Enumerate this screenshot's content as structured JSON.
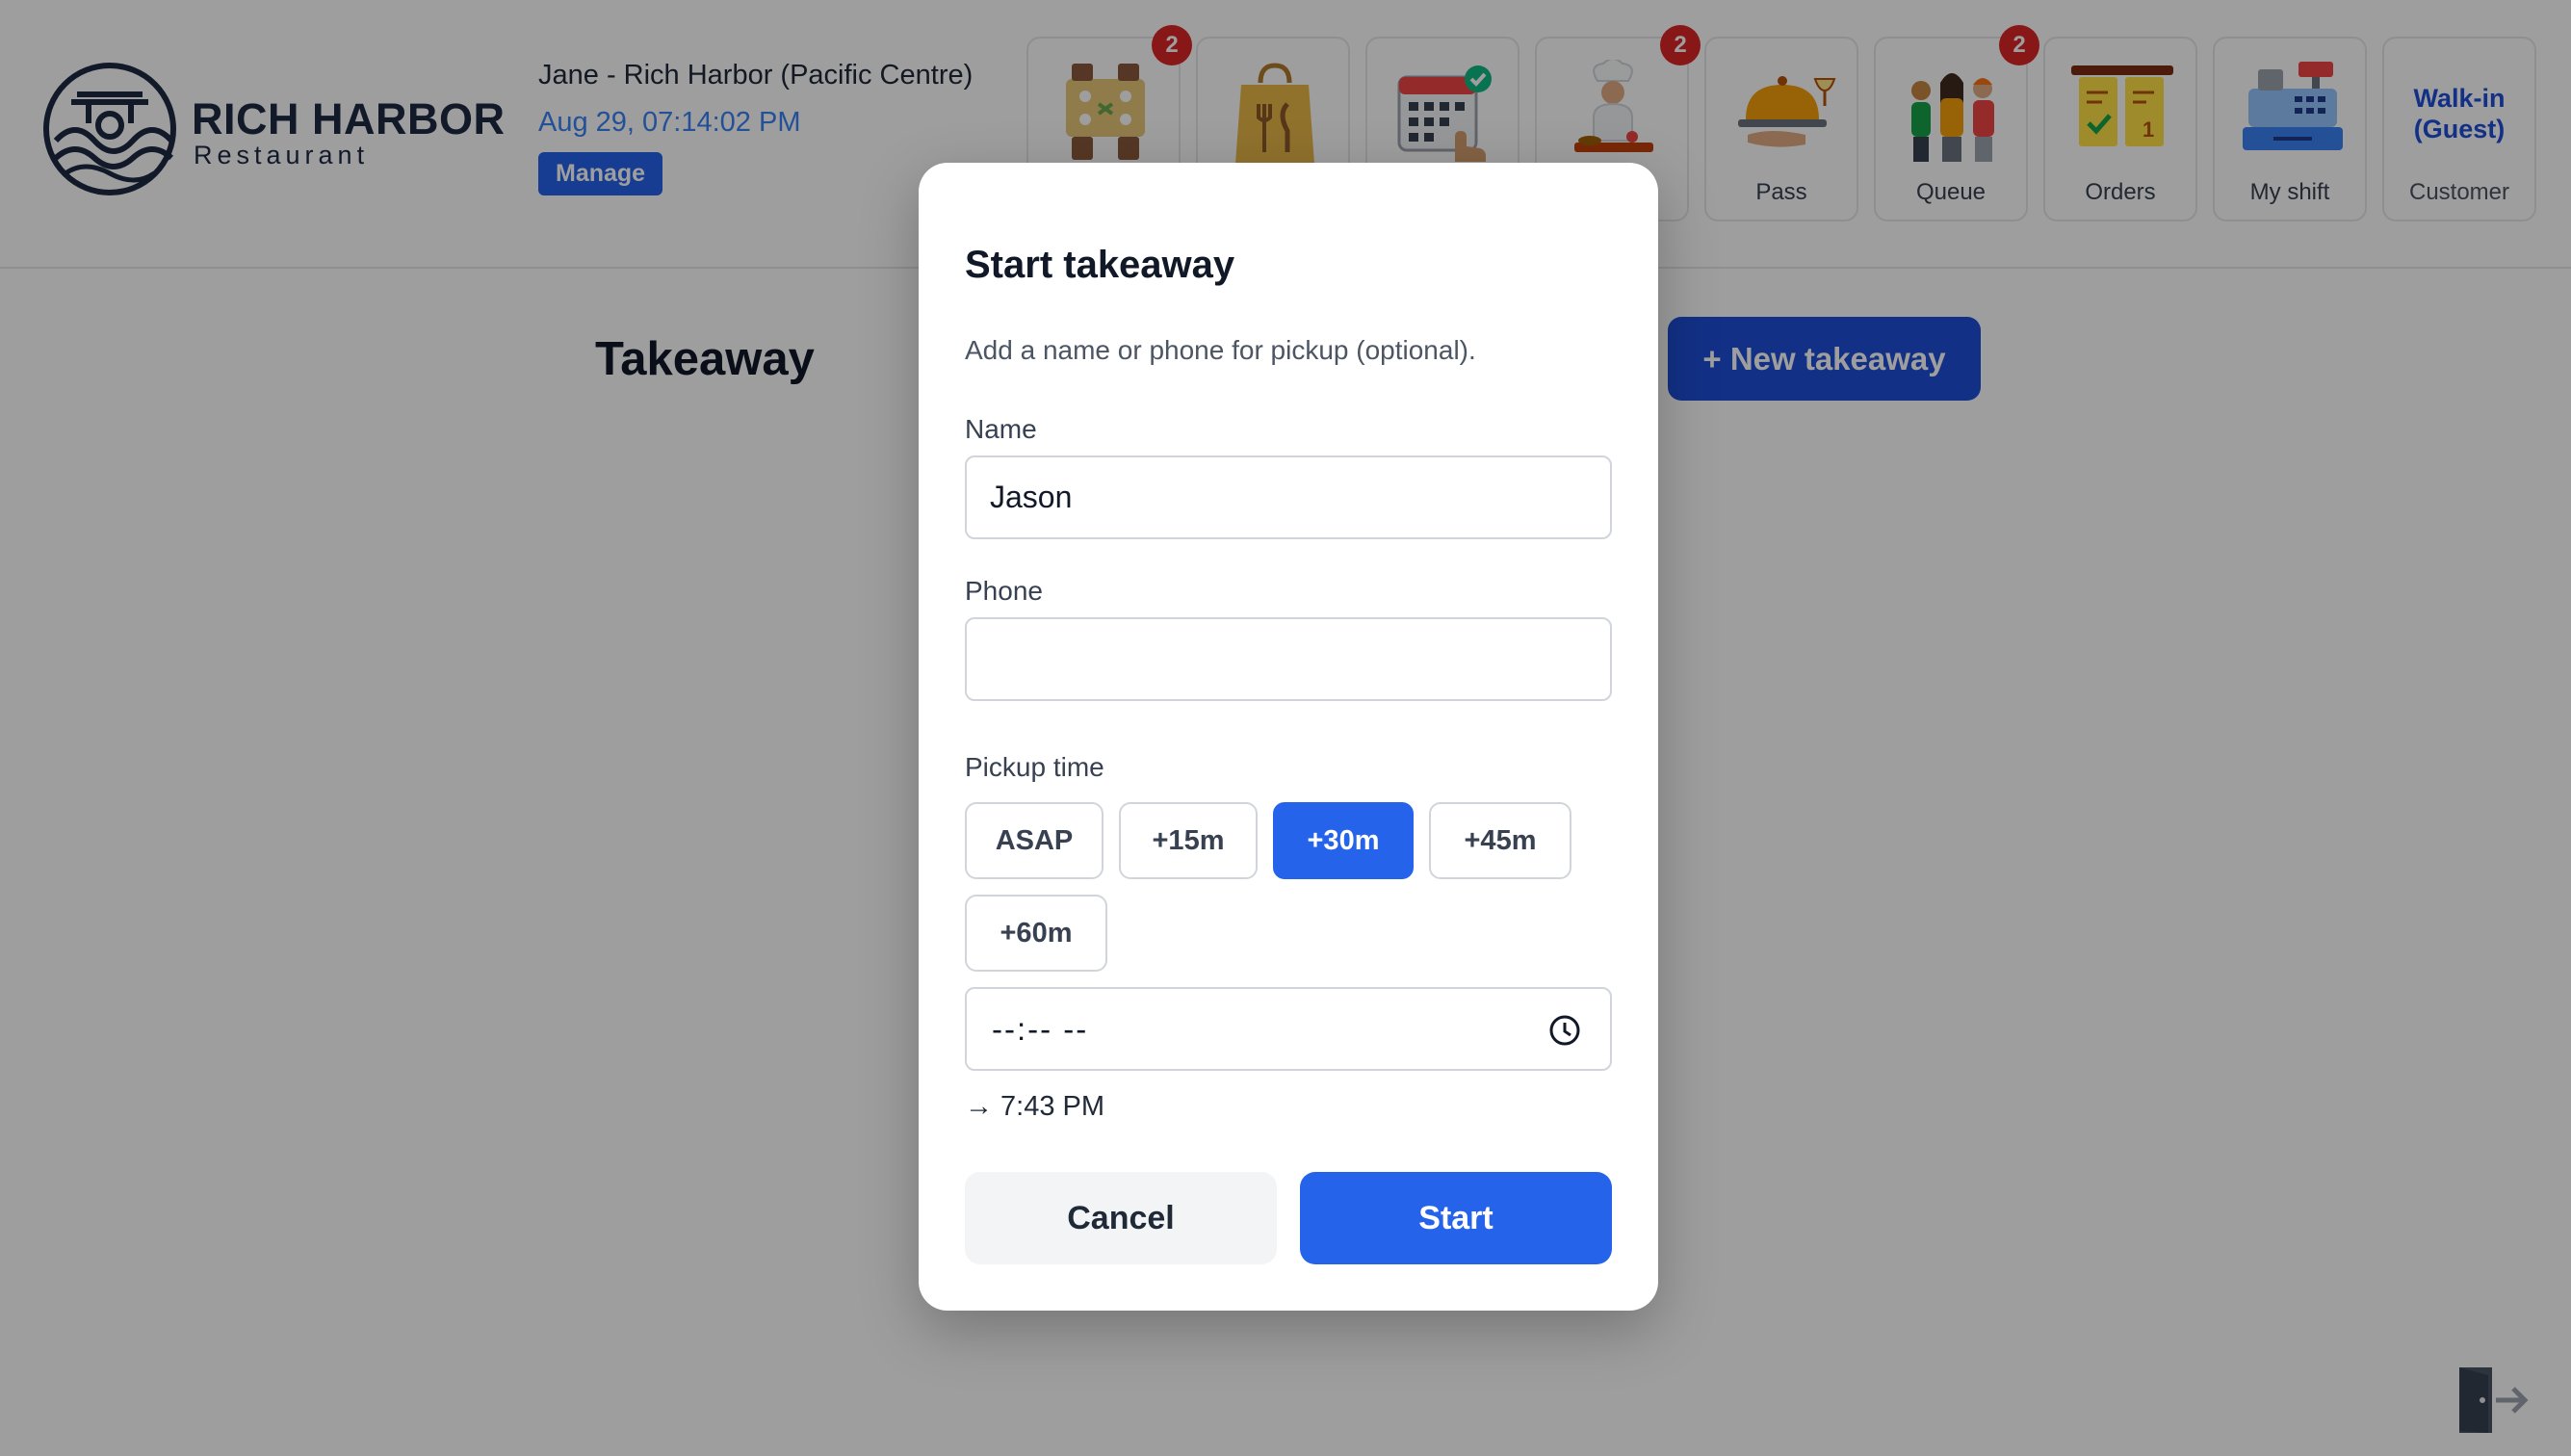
{
  "brand": {
    "name": "RICH HARBOR",
    "subtitle": "Restaurant"
  },
  "user": {
    "name": "Jane - Rich Harbor (Pacific Centre)",
    "datetime": "Aug 29, 07:14:02 PM",
    "manage_label": "Manage"
  },
  "nav": {
    "tiles": [
      {
        "icon": "tables-icon",
        "label": "",
        "badge": "2"
      },
      {
        "icon": "takeaway-bag-icon",
        "label": "",
        "badge": ""
      },
      {
        "icon": "reservations-calendar-icon",
        "label": "",
        "badge": ""
      },
      {
        "icon": "kitchen-chef-icon",
        "label": "",
        "badge": "2"
      },
      {
        "icon": "pass-cloche-icon",
        "label": "Pass",
        "badge": ""
      },
      {
        "icon": "queue-people-icon",
        "label": "Queue",
        "badge": "2"
      },
      {
        "icon": "orders-tickets-icon",
        "label": "Orders",
        "badge": ""
      },
      {
        "icon": "cash-register-icon",
        "label": "My shift",
        "badge": ""
      }
    ],
    "customer": {
      "name": "Walk-in (Guest)",
      "caption": "Customer"
    }
  },
  "main": {
    "title": "Takeaway",
    "new_button": "+ New takeaway"
  },
  "modal": {
    "title": "Start takeaway",
    "description": "Add a name or phone for pickup (optional).",
    "name_label": "Name",
    "name_value": "Jason",
    "phone_label": "Phone",
    "phone_value": "",
    "pickup_label": "Pickup time",
    "pickup_options": [
      "ASAP",
      "+15m",
      "+30m",
      "+45m",
      "+60m"
    ],
    "pickup_selected": "+30m",
    "time_placeholder": "--:-- --",
    "computed_time": "→ 7:43 PM",
    "cancel_label": "Cancel",
    "start_label": "Start"
  },
  "colors": {
    "primary": "#2563eb",
    "primary_dark": "#1d4ed8",
    "badge": "#dc2626",
    "brand_navy": "#1e2a44"
  }
}
